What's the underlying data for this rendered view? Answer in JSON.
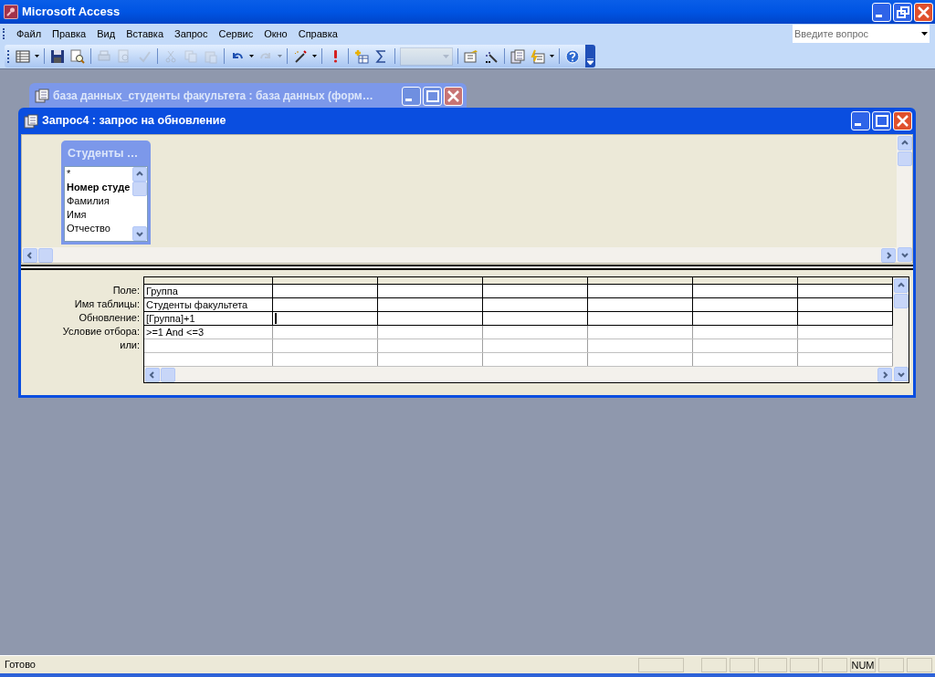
{
  "app": {
    "title": "Microsoft Access"
  },
  "menu": [
    {
      "label": "Файл"
    },
    {
      "label": "Правка"
    },
    {
      "label": "Вид"
    },
    {
      "label": "Вставка"
    },
    {
      "label": "Запрос"
    },
    {
      "label": "Сервис"
    },
    {
      "label": "Окно"
    },
    {
      "label": "Справка"
    }
  ],
  "help_box": {
    "placeholder": "Введите вопрос"
  },
  "toolbar": [
    {
      "kind": "split",
      "disabled": false
    },
    {
      "kind": "separator"
    },
    {
      "kind": "button",
      "disabled": false
    },
    {
      "kind": "button",
      "disabled": false
    },
    {
      "kind": "separator"
    },
    {
      "kind": "button",
      "disabled": true
    },
    {
      "kind": "button",
      "disabled": true
    },
    {
      "kind": "button",
      "disabled": true
    },
    {
      "kind": "separator"
    },
    {
      "kind": "button",
      "disabled": true
    },
    {
      "kind": "button",
      "disabled": true
    },
    {
      "kind": "button",
      "disabled": true
    },
    {
      "kind": "separator"
    },
    {
      "kind": "split",
      "disabled": false
    },
    {
      "kind": "split",
      "disabled": true
    },
    {
      "kind": "separator"
    },
    {
      "kind": "split",
      "disabled": false
    },
    {
      "kind": "separator"
    },
    {
      "kind": "button",
      "disabled": false
    },
    {
      "kind": "separator"
    },
    {
      "kind": "button",
      "disabled": false
    },
    {
      "kind": "button",
      "disabled": false
    },
    {
      "kind": "separator"
    },
    {
      "kind": "combo",
      "disabled": true
    },
    {
      "kind": "separator"
    },
    {
      "kind": "button",
      "disabled": false
    },
    {
      "kind": "button",
      "disabled": false
    },
    {
      "kind": "separator"
    },
    {
      "kind": "button",
      "disabled": false
    },
    {
      "kind": "split",
      "disabled": false
    },
    {
      "kind": "separator"
    },
    {
      "kind": "button",
      "disabled": false
    }
  ],
  "background_window": {
    "title": "база данных_студенты факультета : база данных (форм…"
  },
  "query_window": {
    "title": "Запрос4 : запрос на обновление",
    "table_box": {
      "title": "Студенты …",
      "fields": [
        {
          "text": "*",
          "bold": false
        },
        {
          "text": "Номер студе",
          "bold": true
        },
        {
          "text": "Фамилия",
          "bold": false
        },
        {
          "text": "Имя",
          "bold": false
        },
        {
          "text": "Отчество",
          "bold": false
        }
      ]
    },
    "grid": {
      "rows": [
        {
          "label": "Поле:",
          "value": "Группа"
        },
        {
          "label": "Имя таблицы:",
          "value": "Студенты факультета"
        },
        {
          "label": "Обновление:",
          "value": "[Группа]+1"
        },
        {
          "label": "Условие отбора:",
          "value": ">=1 And <=3"
        },
        {
          "label": "или:"
        },
        {}
      ]
    }
  },
  "status_bar": {
    "text": "Готово",
    "indicators": [
      {
        "text": "NUM"
      }
    ]
  }
}
